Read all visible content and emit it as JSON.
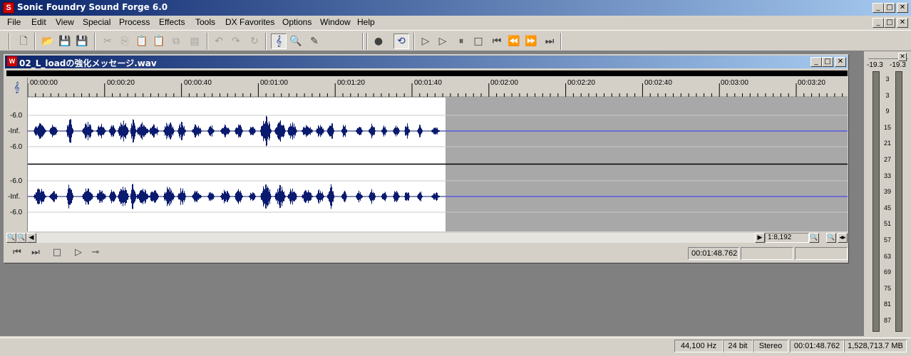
{
  "app": {
    "title": "Sonic Foundry Sound Forge 6.0"
  },
  "menu": [
    "File",
    "Edit",
    "View",
    "Special",
    "Process",
    "Effects",
    "Tools",
    "DX Favorites",
    "Options",
    "Window",
    "Help"
  ],
  "document": {
    "title": "02_L_loadの強化メッセージ.wav",
    "ruler_ticks": [
      "00:00:00",
      "00:00:20",
      "00:00:40",
      "00:01:00",
      "00:01:20",
      "00:01:40",
      "00:02:00",
      "00:02:20",
      "00:02:40",
      "00:03:00",
      "00:03:20"
    ],
    "db_labels": {
      "top": "-6.0",
      "center": "-Inf.",
      "bottom": "-6.0"
    },
    "zoom_ratio": "1:8,192",
    "position": "00:01:48.762"
  },
  "meter": {
    "peak_left": "-19.3",
    "peak_right": "-19.3",
    "scale": [
      "3",
      "3",
      "9",
      "15",
      "21",
      "27",
      "33",
      "39",
      "45",
      "51",
      "57",
      "63",
      "69",
      "75",
      "81",
      "87"
    ]
  },
  "status": {
    "sample_rate": "44,100 Hz",
    "bit_depth": "24 bit",
    "channels": "Stereo",
    "length": "00:01:48.762",
    "disk_free": "1,528,713.7 MB"
  },
  "colors": {
    "waveform": "#0a1a6e",
    "empty_track": "#a8a8a8",
    "center_line": "#3030ff",
    "titlebar": "#0a246a"
  }
}
